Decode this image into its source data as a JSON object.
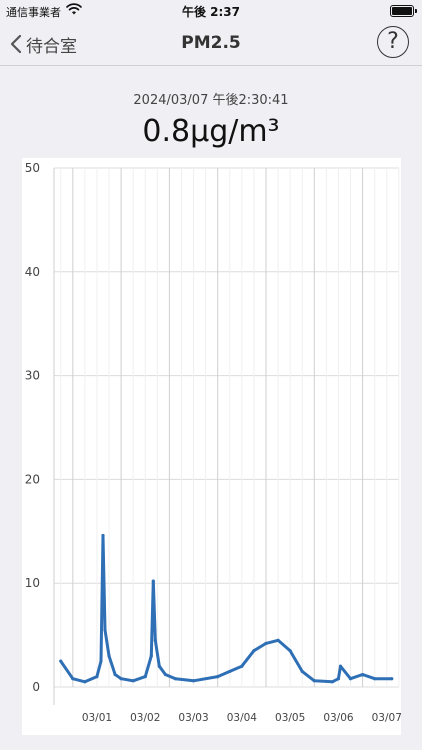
{
  "status_bar": {
    "carrier": "通信事業者",
    "time": "午後 2:37"
  },
  "nav": {
    "back_label": "待合室",
    "title": "PM2.5",
    "help_icon": "?"
  },
  "reading": {
    "timestamp": "2024/03/07 午後2:30:41",
    "value": "0.8μg/m³"
  },
  "chart_data": {
    "type": "line",
    "title": "",
    "xlabel": "",
    "ylabel": "",
    "ylim": [
      0,
      50
    ],
    "y_ticks": [
      0,
      10,
      20,
      30,
      40,
      50
    ],
    "x_tick_labels": [
      "03/01",
      "03/02",
      "03/03",
      "03/04",
      "03/05",
      "03/06",
      "03/07"
    ],
    "grid": true,
    "series_color": "#2e6fb5",
    "series": [
      {
        "x": [
          "2024-02-29 18:00",
          "2024-03-01 00:00",
          "2024-03-01 06:00",
          "2024-03-01 12:00",
          "2024-03-01 14:00",
          "2024-03-01 15:00",
          "2024-03-01 16:00",
          "2024-03-01 18:00",
          "2024-03-01 21:00",
          "2024-03-02 00:00",
          "2024-03-02 06:00",
          "2024-03-02 12:00",
          "2024-03-02 15:00",
          "2024-03-02 16:00",
          "2024-03-02 17:00",
          "2024-03-02 19:00",
          "2024-03-02 22:00",
          "2024-03-03 03:00",
          "2024-03-03 12:00",
          "2024-03-04 00:00",
          "2024-03-04 06:00",
          "2024-03-04 12:00",
          "2024-03-04 18:00",
          "2024-03-05 00:00",
          "2024-03-05 06:00",
          "2024-03-05 12:00",
          "2024-03-05 18:00",
          "2024-03-06 00:00",
          "2024-03-06 09:00",
          "2024-03-06 12:00",
          "2024-03-06 13:00",
          "2024-03-06 18:00",
          "2024-03-07 00:00",
          "2024-03-07 06:00",
          "2024-03-07 14:30"
        ],
        "values": [
          2.5,
          0.8,
          0.5,
          1.0,
          2.5,
          14.6,
          5.5,
          3.0,
          1.2,
          0.8,
          0.6,
          1.0,
          3.0,
          10.2,
          4.5,
          2.0,
          1.2,
          0.8,
          0.6,
          1.0,
          1.5,
          2.0,
          3.5,
          4.2,
          4.5,
          3.5,
          1.5,
          0.6,
          0.5,
          0.8,
          2.0,
          0.8,
          1.2,
          0.8,
          0.8
        ]
      }
    ]
  }
}
